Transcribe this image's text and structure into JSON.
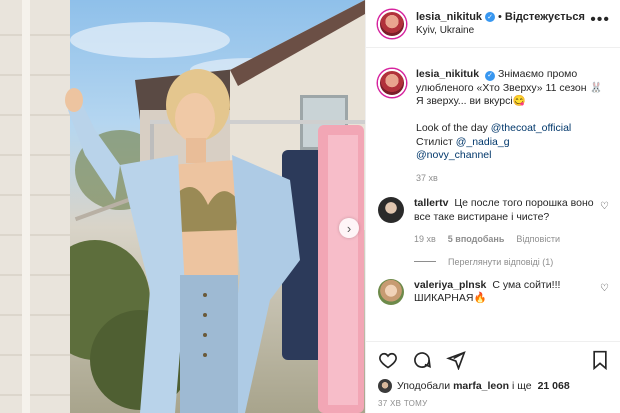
{
  "post": {
    "username": "lesia_nikituk",
    "follow_status": "Відстежується",
    "dot": "•",
    "location": "Kyiv, Ukraine",
    "more_icon": "more-horizontal-icon"
  },
  "caption": {
    "username": "lesia_nikituk",
    "text_1": "Знімаємо промо улюбленого «Хто Зверху» 11 сезон",
    "emoji_1": "🐰",
    "text_2": "Я зверху... ви вкурсі",
    "emoji_2": "😋",
    "text_3": "Look of the day ",
    "mention_1": "@thecoat_official",
    "text_4": "Стиліст ",
    "mention_2": "@_nadia_g",
    "mention_3": "@novy_channel",
    "time": "37 хв"
  },
  "comments": [
    {
      "username": "tallertv",
      "text": "Це после того порошка воно все таке вистиране і чисте?",
      "time": "19 хв",
      "likes": "5 вподобань",
      "reply": "Відповісти",
      "view_replies": "Переглянути відповіді (1)"
    },
    {
      "username": "valeriya_plnsk",
      "text": "С ума сойти!!! ШИКАРНАЯ",
      "emoji": "🔥"
    }
  ],
  "likes": {
    "prefix": "Уподобали ",
    "user": "marfa_leon",
    "middle": " і ще ",
    "count": "21 068"
  },
  "timestamp": "37 ХВ ТОМУ",
  "colors": {
    "verified": "#3897f0",
    "mention": "#00376b",
    "muted": "#8e8e8e",
    "border": "#efefef"
  }
}
